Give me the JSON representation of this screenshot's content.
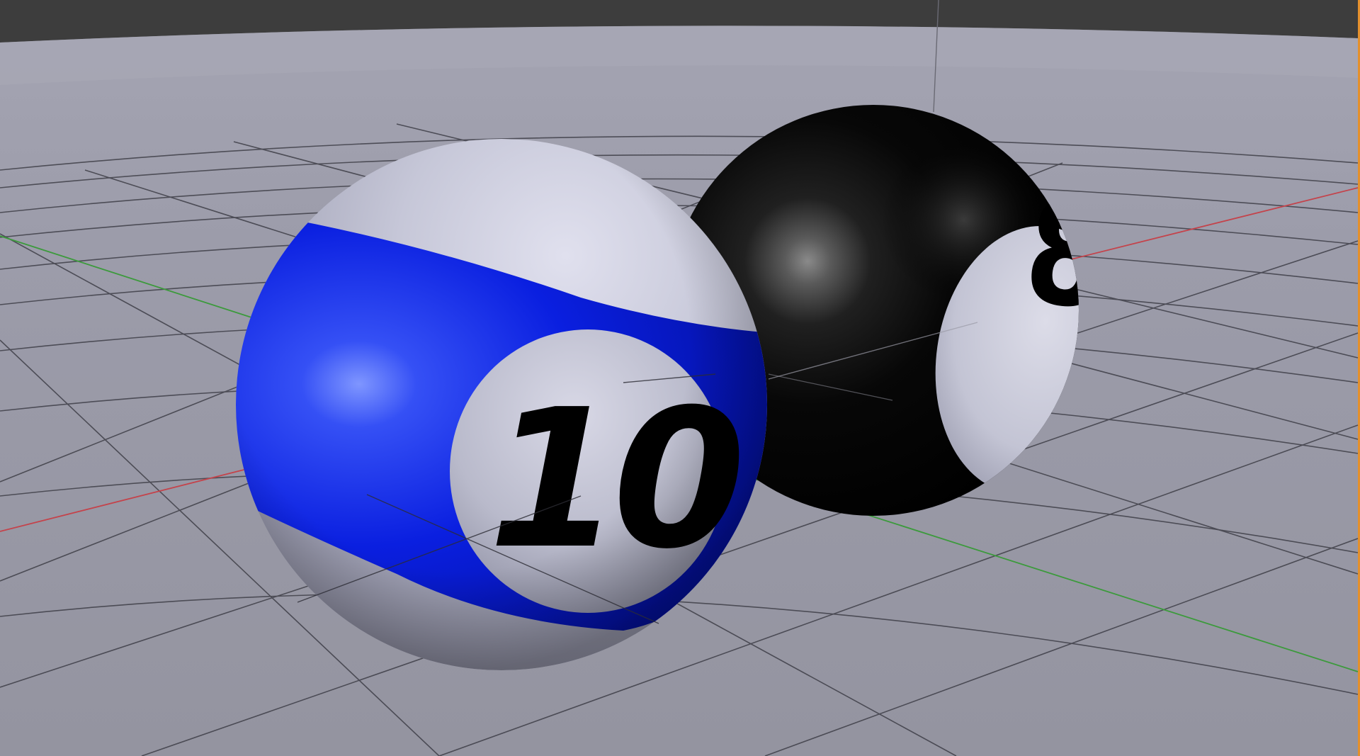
{
  "viewport": {
    "header_color": "#3d3d3d",
    "sky_color": "#9d9dab",
    "floor_color": "#9a9aa6",
    "grid_color": "#3f3f48",
    "axis_x_color": "#c4434b",
    "axis_y_color": "#3c9a3c",
    "active_border_color": "#e4902c"
  },
  "objects": [
    {
      "name": "pool ball",
      "number": "10",
      "stripe_color": "#0a1fe0",
      "base_color": "#c4c5d6",
      "text_color": "#000000"
    },
    {
      "name": "8 ball",
      "number": "8",
      "base_color": "#000000",
      "circle_color": "#c8c9d7",
      "text_color": "#000000"
    }
  ]
}
